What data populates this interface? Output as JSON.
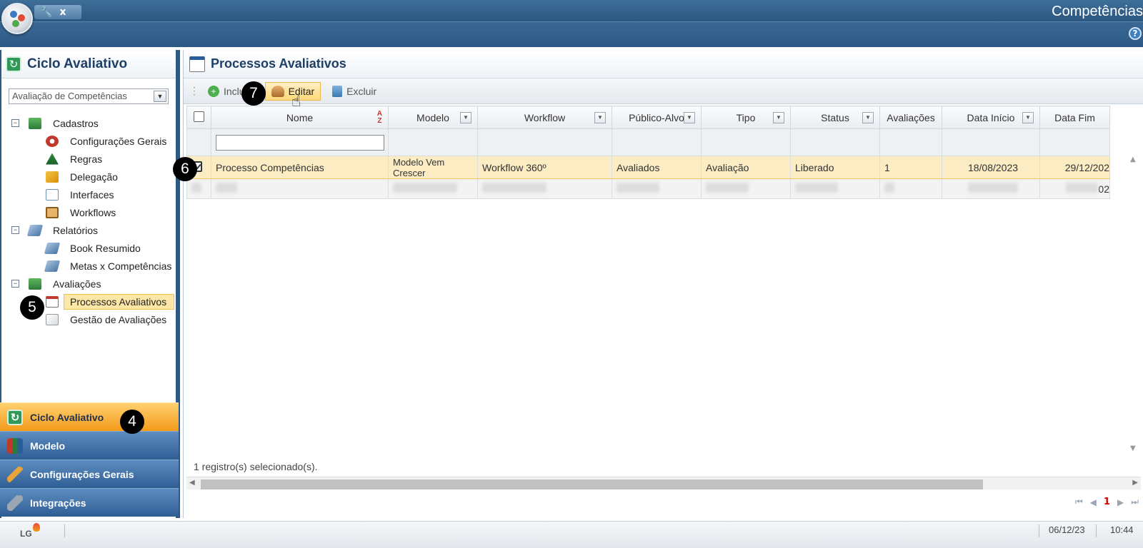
{
  "app": {
    "title": "Competências",
    "help": "?"
  },
  "quicktools": {
    "close": "x"
  },
  "left": {
    "title": "Ciclo Avaliativo",
    "select": {
      "value": "Avaliação de Competências"
    },
    "tree": {
      "cadastros": "Cadastros",
      "config": "Configurações Gerais",
      "regras": "Regras",
      "delegacao": "Delegação",
      "interfaces": "Interfaces",
      "workflows": "Workflows",
      "relatorios": "Relatórios",
      "book": "Book Resumido",
      "metas": "Metas x Competências",
      "avaliacoes": "Avaliações",
      "processos": "Processos Avaliativos",
      "gestao": "Gestão de Avaliações"
    },
    "accordion": [
      "Ciclo Avaliativo",
      "Modelo",
      "Configurações Gerais",
      "Integrações"
    ]
  },
  "main": {
    "title": "Processos Avaliativos",
    "toolbar": {
      "incluir": "Inclu",
      "editar": "Editar",
      "excluir": "Excluir"
    },
    "columns": [
      "Nome",
      "Modelo",
      "Workflow",
      "Público-Alvo",
      "Tipo",
      "Status",
      "Avaliações",
      "Data Início",
      "Data Fim"
    ],
    "sort_icon": "A-Z",
    "row": {
      "nome": "Processo Competências",
      "modelo1": "Modelo Vem",
      "modelo2": "Crescer",
      "workflow": "Workflow 360º",
      "publico": "Avaliados",
      "tipo": "Avaliação",
      "status": "Liberado",
      "avaliacoes": "1",
      "inicio": "18/08/2023",
      "fim": "29/12/202"
    },
    "row2_fim_fragment": "02",
    "selection_status": "1 registro(s) selecionado(s).",
    "pager": {
      "page": "1"
    }
  },
  "statusbar": {
    "logo": "LG",
    "date": "06/12/23",
    "time": "10:44"
  },
  "markers": [
    "4",
    "5",
    "6",
    "7"
  ]
}
